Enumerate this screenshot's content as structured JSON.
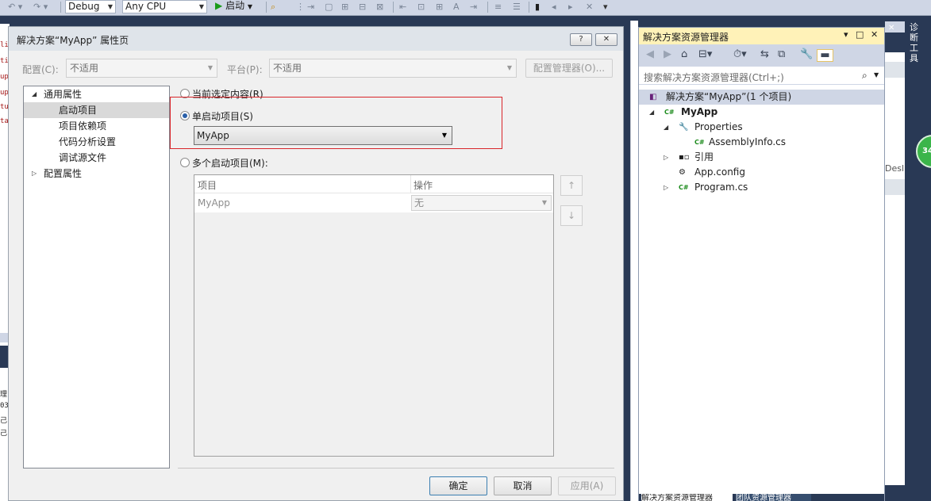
{
  "toolbar": {
    "config_value": "Debug",
    "platform_value": "Any CPU",
    "start_label": "启动"
  },
  "dialog": {
    "title": "解决方案“MyApp” 属性页",
    "help_label": "?",
    "close_label": "✕",
    "config_label": "配置(C):",
    "config_value": "不适用",
    "platform_label": "平台(P):",
    "platform_value": "不适用",
    "config_manager_label": "配置管理器(O)...",
    "tree": [
      {
        "label": "通用属性"
      },
      {
        "label": "启动项目"
      },
      {
        "label": "项目依赖项"
      },
      {
        "label": "代码分析设置"
      },
      {
        "label": "调试源文件"
      },
      {
        "label": "配置属性"
      }
    ],
    "radio_current": "当前选定内容(R)",
    "radio_single": "单启动项目(S)",
    "single_project_value": "MyApp",
    "radio_multiple": "多个启动项目(M):",
    "grid": {
      "col_project": "项目",
      "col_action": "操作",
      "rows": [
        {
          "project": "MyApp",
          "action": "无"
        }
      ]
    },
    "move_up_label": "↑",
    "move_down_label": "↓",
    "ok_label": "确定",
    "cancel_label": "取消",
    "apply_label": "应用(A)"
  },
  "solution_explorer": {
    "title": "解决方案资源管理器",
    "search_placeholder": "搜索解决方案资源管理器(Ctrl+;)",
    "nodes": [
      {
        "label": "解决方案“MyApp”(1 个项目)"
      },
      {
        "label": "MyApp"
      },
      {
        "label": "Properties"
      },
      {
        "label": "AssemblyInfo.cs"
      },
      {
        "label": "引用"
      },
      {
        "label": "App.config"
      },
      {
        "label": "Program.cs"
      }
    ],
    "bottom_tab_1": "解决方案资源管理器",
    "bottom_tab_2": "团队资源管理器"
  },
  "far_right": {
    "vertical_tab": "诊断工具",
    "badge": "34",
    "partial_text": "Desl"
  }
}
